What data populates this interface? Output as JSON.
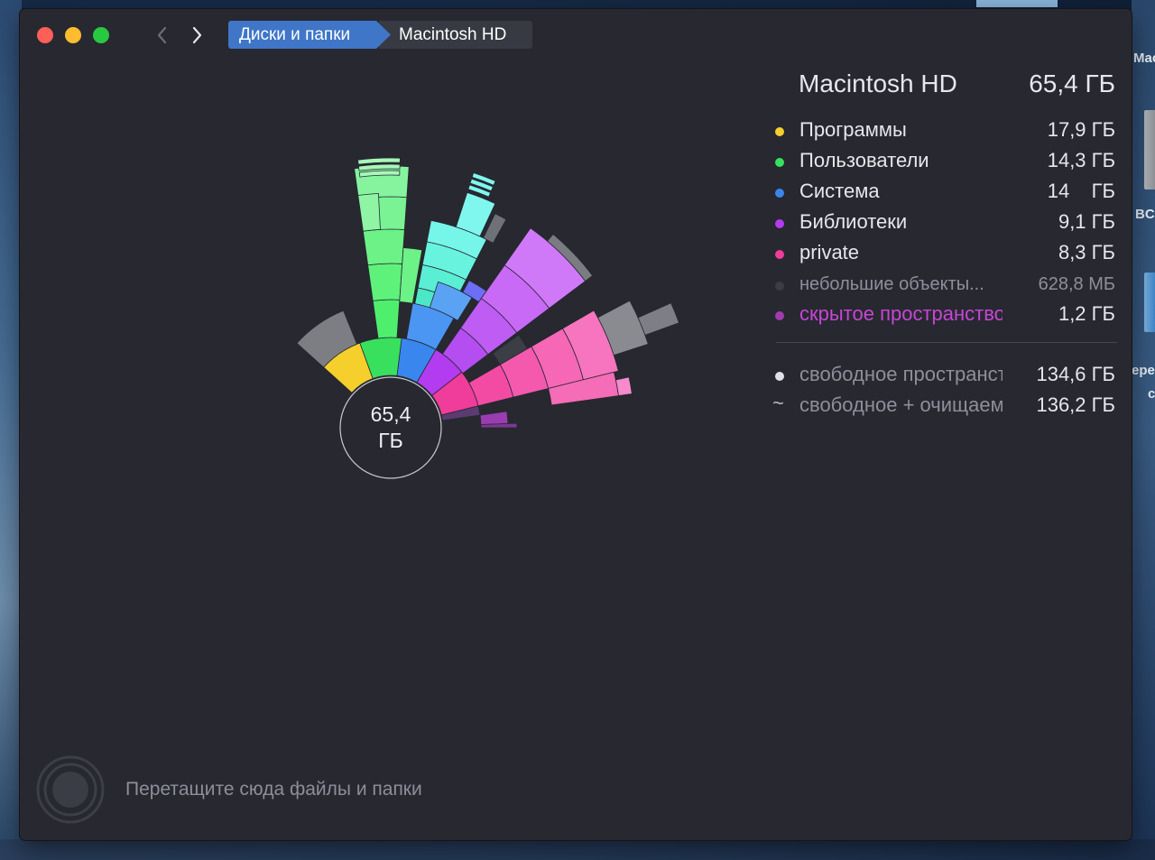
{
  "desktop": {
    "label_top": "Mac",
    "label_mid": "BC",
    "label_low_1": "epe",
    "label_low_2": "c"
  },
  "toolbar": {
    "back_icon": "chevron-left-icon",
    "forward_icon": "chevron-right-icon",
    "breadcrumb": [
      "Диски и папки",
      "Macintosh HD"
    ]
  },
  "chart": {
    "center_value": "65,4",
    "center_unit": "ГБ"
  },
  "legend": {
    "title": "Macintosh HD",
    "total": "65,4 ГБ",
    "items": [
      {
        "label": "Программы",
        "value": "17,9 ГБ",
        "color": "#f5cf2c"
      },
      {
        "label": "Пользователи",
        "value": "14,3 ГБ",
        "color": "#39e05e"
      },
      {
        "label": "Система",
        "value": "14    ГБ",
        "color": "#3a86ef"
      },
      {
        "label": "Библиотеки",
        "value": "9,1 ГБ",
        "color": "#b33cf0"
      },
      {
        "label": "private",
        "value": "8,3 ГБ",
        "color": "#f03c9a"
      },
      {
        "label": "небольшие объекты...",
        "value": "628,8 МБ",
        "color": "#3c3e46"
      },
      {
        "label": "скрытое пространство",
        "value": "1,2 ГБ",
        "color": "#a23bb0"
      }
    ],
    "free": [
      {
        "label": "свободное пространство",
        "value": "134,6 ГБ",
        "marker": "●"
      },
      {
        "label": "свободное + очищаемое",
        "value": "136,2 ГБ",
        "marker": "~"
      }
    ]
  },
  "footer": {
    "drop_hint": "Перетащите сюда файлы и папки",
    "icon": "drop-target-icon"
  }
}
